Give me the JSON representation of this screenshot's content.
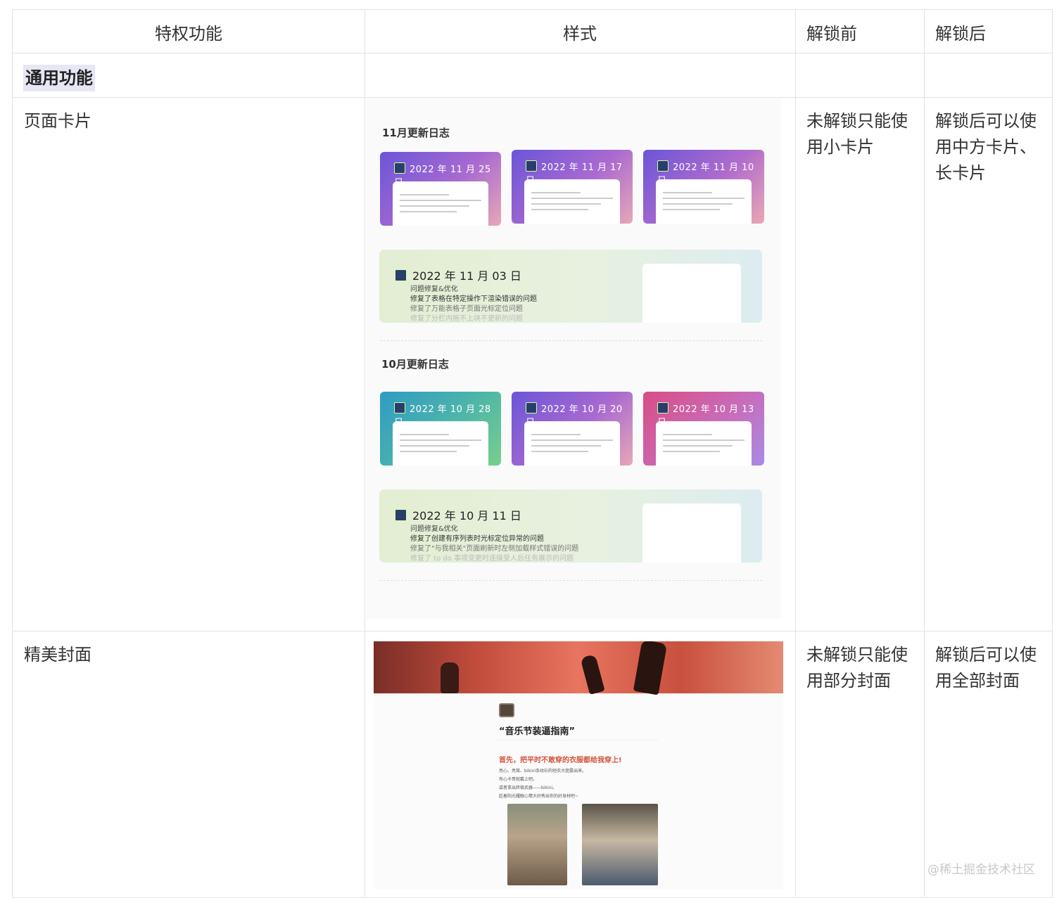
{
  "table": {
    "headers": {
      "feature": "特权功能",
      "style": "样式",
      "before": "解锁前",
      "after": "解锁后"
    },
    "section": "通用功能",
    "rows": [
      {
        "feature": "页面卡片",
        "before": "未解锁只能使用小卡片",
        "after": "解锁后可以使用中方卡片、长卡片"
      },
      {
        "feature": "精美封面",
        "before": "未解锁只能使用部分封面",
        "after": "解锁后可以使用全部封面"
      }
    ]
  },
  "card_preview": {
    "nov_title": "11月更新日志",
    "nov_cards": [
      "2022 年 11 月 25 日",
      "2022 年 11 月 17 日",
      "2022 年 11 月 10 日"
    ],
    "nov_long": {
      "date": "2022 年 11 月 03 日",
      "lines": [
        "问题修复&优化",
        "修复了表格在特定操作下渲染错误的问题",
        "修复了万能表格子页面光标定位问题",
        "修复了分栏内拖不上块不更新的问题"
      ]
    },
    "oct_title": "10月更新日志",
    "oct_cards": [
      "2022 年 10 月 28 日",
      "2022 年 10 月 20 日",
      "2022 年 10 月 13 日"
    ],
    "oct_long": {
      "date": "2022 年 10 月 11 日",
      "lines": [
        "问题修复&优化",
        "修复了创建有序列表时光标定位异常的问题",
        "修复了\"与我相关\"页面刷新时左侧加载样式错误的问题",
        "修复了 to do 事项变更时连接受人后任务展示的问题"
      ]
    }
  },
  "cover_preview": {
    "doc_title": "“音乐节装逼指南”",
    "headline": "首先，把平时不敢穿的衣服都给我穿上!",
    "lines": [
      "亮心、亮茸、bikini条纹衫的短衣大胆露出来。",
      "有心卡哥就戴上吧。",
      "或者拿出终极武器——bikini。",
      "趁着阳光耀眼心情大好秀出你的好身材吧~"
    ]
  },
  "watermark": "@稀土掘金技术社区",
  "colors": {
    "border": "#e2e2e2",
    "section_bg": "#e6e6f5",
    "headline_red": "#d4533a"
  }
}
